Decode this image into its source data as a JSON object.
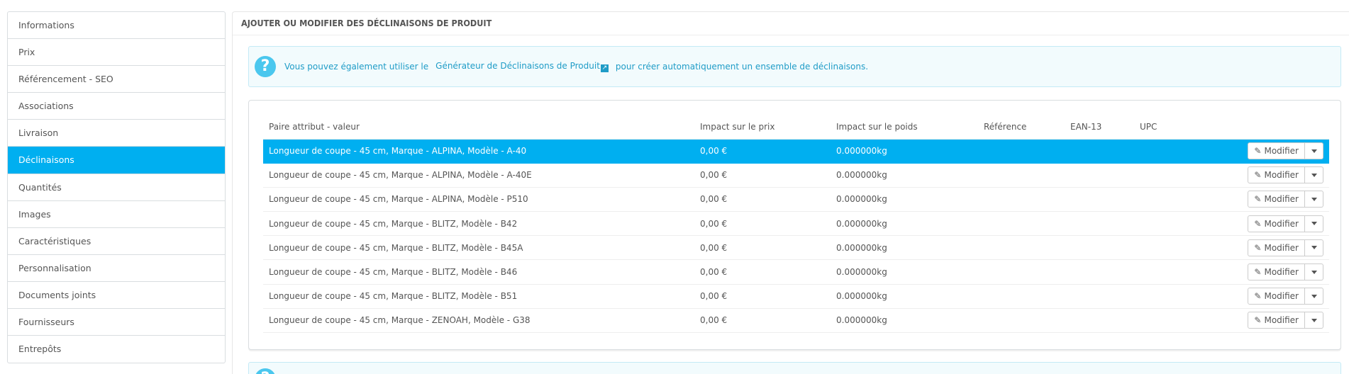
{
  "sidebar": {
    "items": [
      {
        "label": "Informations"
      },
      {
        "label": "Prix"
      },
      {
        "label": "Référencement - SEO"
      },
      {
        "label": "Associations"
      },
      {
        "label": "Livraison"
      },
      {
        "label": "Déclinaisons",
        "active": true
      },
      {
        "label": "Quantités"
      },
      {
        "label": "Images"
      },
      {
        "label": "Caractéristiques"
      },
      {
        "label": "Personnalisation"
      },
      {
        "label": "Documents joints"
      },
      {
        "label": "Fournisseurs"
      },
      {
        "label": "Entrepôts"
      }
    ]
  },
  "panel": {
    "title": "AJOUTER OU MODIFIER DES DÉCLINAISONS DE PRODUIT"
  },
  "alert": {
    "icon": "question-circle-icon",
    "text_before": "Vous pouvez également utiliser le",
    "link": "Générateur de Déclinaisons de Produit",
    "text_after": "pour créer automatiquement un ensemble de déclinaisons."
  },
  "table": {
    "headers": {
      "attribute": "Paire attribut - valeur",
      "price": "Impact sur le prix",
      "weight": "Impact sur le poids",
      "reference": "Référence",
      "ean": "EAN-13",
      "upc": "UPC"
    },
    "rows": [
      {
        "attribute": "Longueur de coupe - 45 cm, Marque - ALPINA, Modèle - A-40",
        "price": "0,00 €",
        "weight": "0.000000kg",
        "selected": true
      },
      {
        "attribute": "Longueur de coupe - 45 cm, Marque - ALPINA, Modèle - A-40E",
        "price": "0,00 €",
        "weight": "0.000000kg"
      },
      {
        "attribute": "Longueur de coupe - 45 cm, Marque - ALPINA, Modèle - P510",
        "price": "0,00 €",
        "weight": "0.000000kg"
      },
      {
        "attribute": "Longueur de coupe - 45 cm, Marque - BLITZ, Modèle - B42",
        "price": "0,00 €",
        "weight": "0.000000kg"
      },
      {
        "attribute": "Longueur de coupe - 45 cm, Marque - BLITZ, Modèle - B45A",
        "price": "0,00 €",
        "weight": "0.000000kg"
      },
      {
        "attribute": "Longueur de coupe - 45 cm, Marque - BLITZ, Modèle - B46",
        "price": "0,00 €",
        "weight": "0.000000kg"
      },
      {
        "attribute": "Longueur de coupe - 45 cm, Marque - BLITZ, Modèle - B51",
        "price": "0,00 €",
        "weight": "0.000000kg"
      },
      {
        "attribute": "Longueur de coupe - 45 cm, Marque - ZENOAH, Modèle - G38",
        "price": "0,00 €",
        "weight": "0.000000kg"
      }
    ],
    "edit_label": "Modifier",
    "edit_icon": "pencil-icon",
    "caret_icon": "caret-down-icon"
  },
  "colors": {
    "accent": "#00aff0",
    "alert_bg": "#f2fbfd",
    "alert_text": "#1f9cc7"
  }
}
